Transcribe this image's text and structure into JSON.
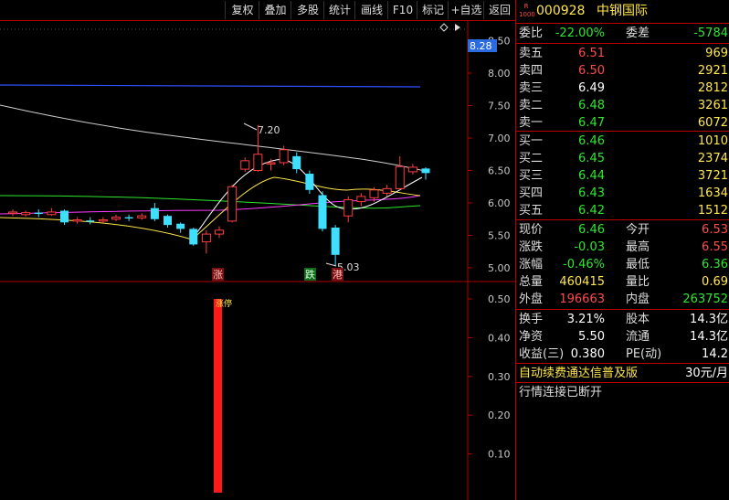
{
  "toolbar": {
    "buttons": [
      "复权",
      "叠加",
      "多股",
      "统计",
      "画线",
      "F10",
      "标记",
      "+自选",
      "返回"
    ]
  },
  "stock": {
    "badge_top": "R",
    "badge_bottom": "1000",
    "code": "000928",
    "name": "中钢国际"
  },
  "committee": {
    "ratio_label": "委比",
    "ratio_value": "-22.00%",
    "diff_label": "委差",
    "diff_value": "-5784"
  },
  "sell": [
    {
      "label": "卖五",
      "price": "6.51",
      "vol": "969"
    },
    {
      "label": "卖四",
      "price": "6.50",
      "vol": "2921"
    },
    {
      "label": "卖三",
      "price": "6.49",
      "vol": "2812"
    },
    {
      "label": "卖二",
      "price": "6.48",
      "vol": "3261"
    },
    {
      "label": "卖一",
      "price": "6.47",
      "vol": "6072"
    }
  ],
  "buy": [
    {
      "label": "买一",
      "price": "6.46",
      "vol": "1010"
    },
    {
      "label": "买二",
      "price": "6.45",
      "vol": "2374"
    },
    {
      "label": "买三",
      "price": "6.44",
      "vol": "3721"
    },
    {
      "label": "买四",
      "price": "6.43",
      "vol": "1634"
    },
    {
      "label": "买五",
      "price": "6.42",
      "vol": "1512"
    }
  ],
  "quote": [
    {
      "l1": "现价",
      "v1": "6.46",
      "l2": "今开",
      "v2": "6.53"
    },
    {
      "l1": "涨跌",
      "v1": "-0.03",
      "l2": "最高",
      "v2": "6.55"
    },
    {
      "l1": "涨幅",
      "v1": "-0.46%",
      "l2": "最低",
      "v2": "6.36"
    },
    {
      "l1": "总量",
      "v1": "460415",
      "l2": "量比",
      "v2": "0.69"
    },
    {
      "l1": "外盘",
      "v1": "196663",
      "l2": "内盘",
      "v2": "263752"
    }
  ],
  "fund": [
    {
      "l1": "换手",
      "v1": "3.21%",
      "l2": "股本",
      "v2": "14.3亿"
    },
    {
      "l1": "净资",
      "v1": "5.50",
      "l2": "流通",
      "v2": "14.3亿"
    },
    {
      "l1": "收益(三)",
      "v1": "0.380",
      "l2": "PE(动)",
      "v2": "14.2"
    }
  ],
  "promo": {
    "text": "自动续费通达信普及版",
    "price": "30元/月"
  },
  "status": "行情连接已断开",
  "chart_data": {
    "type": "candlestick",
    "price_ticks": [
      "8.50",
      "8.00",
      "7.50",
      "7.00",
      "6.50",
      "6.00",
      "5.50",
      "5.00"
    ],
    "current_price_tag": "8.28",
    "high_annotation": "7.20",
    "low_annotation": "5.03",
    "markers": [
      "涨",
      "跌",
      "港"
    ],
    "candles": [
      {
        "o": 5.84,
        "c": 5.86,
        "h": 5.9,
        "l": 5.8
      },
      {
        "o": 5.82,
        "c": 5.85,
        "h": 5.88,
        "l": 5.79
      },
      {
        "o": 5.85,
        "c": 5.83,
        "h": 5.9,
        "l": 5.78
      },
      {
        "o": 5.82,
        "c": 5.86,
        "h": 5.92,
        "l": 5.8
      },
      {
        "o": 5.88,
        "c": 5.7,
        "h": 5.9,
        "l": 5.66
      },
      {
        "o": 5.72,
        "c": 5.74,
        "h": 5.78,
        "l": 5.68
      },
      {
        "o": 5.73,
        "c": 5.71,
        "h": 5.78,
        "l": 5.67
      },
      {
        "o": 5.72,
        "c": 5.74,
        "h": 5.78,
        "l": 5.69
      },
      {
        "o": 5.75,
        "c": 5.78,
        "h": 5.82,
        "l": 5.72
      },
      {
        "o": 5.78,
        "c": 5.76,
        "h": 5.82,
        "l": 5.72
      },
      {
        "o": 5.77,
        "c": 5.8,
        "h": 5.84,
        "l": 5.74
      },
      {
        "o": 5.92,
        "c": 5.75,
        "h": 6.0,
        "l": 5.72
      },
      {
        "o": 5.8,
        "c": 5.66,
        "h": 5.82,
        "l": 5.62
      },
      {
        "o": 5.68,
        "c": 5.6,
        "h": 5.7,
        "l": 5.54
      },
      {
        "o": 5.6,
        "c": 5.36,
        "h": 5.62,
        "l": 5.34
      },
      {
        "o": 5.4,
        "c": 5.52,
        "h": 5.58,
        "l": 5.22
      },
      {
        "o": 5.52,
        "c": 5.58,
        "h": 5.64,
        "l": 5.46
      },
      {
        "o": 5.72,
        "c": 6.25,
        "h": 6.28,
        "l": 5.7
      },
      {
        "o": 6.52,
        "c": 6.65,
        "h": 6.7,
        "l": 6.48
      },
      {
        "o": 6.5,
        "c": 6.75,
        "h": 7.2,
        "l": 6.48
      },
      {
        "o": 6.6,
        "c": 6.62,
        "h": 6.68,
        "l": 6.5
      },
      {
        "o": 6.62,
        "c": 6.82,
        "h": 6.88,
        "l": 6.58
      },
      {
        "o": 6.72,
        "c": 6.52,
        "h": 6.78,
        "l": 6.46
      },
      {
        "o": 6.45,
        "c": 6.2,
        "h": 6.5,
        "l": 6.14
      },
      {
        "o": 6.12,
        "c": 5.6,
        "h": 6.18,
        "l": 5.56
      },
      {
        "o": 5.62,
        "c": 5.2,
        "h": 5.66,
        "l": 5.03
      },
      {
        "o": 5.8,
        "c": 6.05,
        "h": 6.1,
        "l": 5.7
      },
      {
        "o": 6.02,
        "c": 6.1,
        "h": 6.15,
        "l": 5.95
      },
      {
        "o": 6.08,
        "c": 6.2,
        "h": 6.24,
        "l": 6.02
      },
      {
        "o": 6.15,
        "c": 6.22,
        "h": 6.28,
        "l": 6.1
      },
      {
        "o": 6.22,
        "c": 6.56,
        "h": 6.72,
        "l": 6.2
      },
      {
        "o": 6.48,
        "c": 6.55,
        "h": 6.6,
        "l": 6.44
      },
      {
        "o": 6.53,
        "c": 6.46,
        "h": 6.55,
        "l": 6.36
      }
    ],
    "volume_ticks": [
      "0.50",
      "0.40",
      "0.30",
      "0.20",
      "0.10"
    ],
    "volume_bar_label": "涨停",
    "volume_bar_value": 0.5
  },
  "colors": {
    "up": "#ff3d3d",
    "down": "#3fe0ff",
    "axis": "#b00000",
    "bg": "#000000",
    "blue_line": "#3050ff"
  }
}
